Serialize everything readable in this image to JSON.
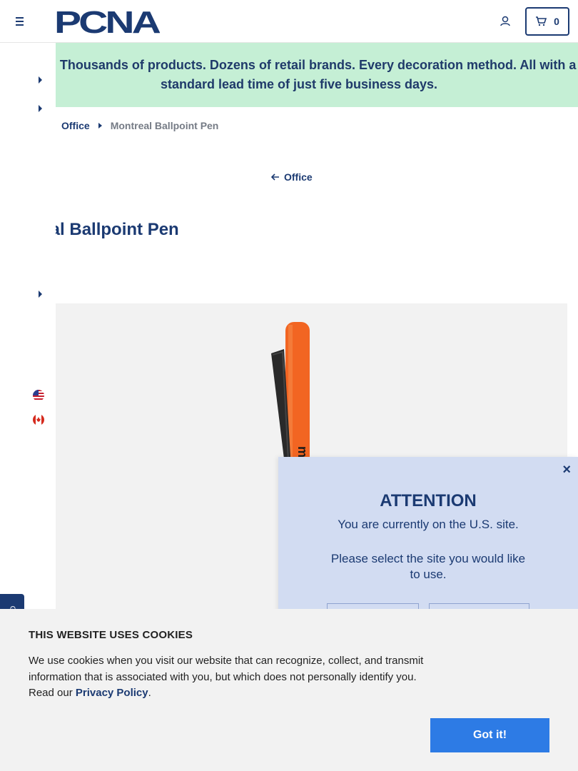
{
  "header": {
    "logo_text": "PCNA",
    "cart_count": "0"
  },
  "promo": {
    "text": "Wait? Thousands of products. Dozens of retail brands. Every decoration method. All with a standard lead time of just five business days."
  },
  "breadcrumb": {
    "items": [
      "Office",
      "Montreal Ballpoint Pen"
    ]
  },
  "back_link": {
    "label": "Office"
  },
  "product": {
    "title": "treal Ballpoint Pen",
    "pen_imprint": "merit"
  },
  "sidebar": {
    "flags": [
      "us-flag-icon",
      "canada-flag-icon"
    ]
  },
  "attention_modal": {
    "title": "ATTENTION",
    "line1": "You are currently on the U.S. site.",
    "line2": "Please select the site you would like to use.",
    "close": "×"
  },
  "feedback_tab": {
    "label": "G"
  },
  "cookie_banner": {
    "title": "THIS WEBSITE USES COOKIES",
    "body": "We use cookies when you visit our website that can recognize, collect, and transmit information that is associated with you, but which does not personally identify you. Read our ",
    "link": "Privacy Policy",
    "period": ".",
    "button": "Got it!"
  },
  "colors": {
    "brand_navy": "#1b3a72",
    "promo_bg": "#c5efd5",
    "modal_bg": "#d2dcf2",
    "button_blue": "#2d7be5",
    "pen_orange": "#f26522"
  }
}
